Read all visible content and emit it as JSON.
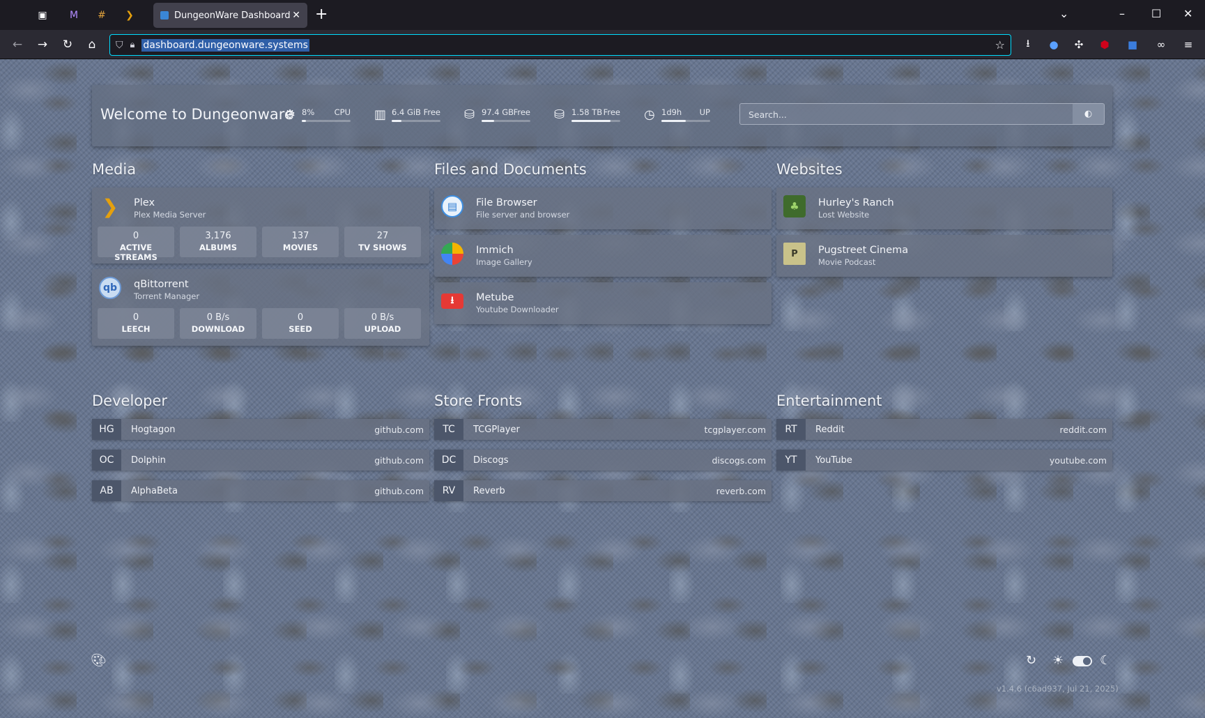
{
  "browser": {
    "tab_title": "DungeonWare Dashboard",
    "url": "dashboard.dungeonware.systems"
  },
  "header": {
    "title": "Welcome to Dungeonware",
    "search_placeholder": "Search...",
    "stats": [
      {
        "icon": "cpu-icon",
        "value": "8%",
        "label": "CPU",
        "fill": 0.08
      },
      {
        "icon": "memory-icon",
        "value": "6.4 GiB",
        "label": "Free",
        "fill": 0.2
      },
      {
        "icon": "disk-icon",
        "value": "97.4 GB",
        "label": "Free",
        "fill": 0.25
      },
      {
        "icon": "disk-icon",
        "value": "1.58 TB",
        "label": "Free",
        "fill": 0.8
      },
      {
        "icon": "clock-icon",
        "value": "1d9h",
        "label": "UP",
        "fill": 0.5
      }
    ]
  },
  "sections": {
    "media": "Media",
    "files": "Files and Documents",
    "websites": "Websites",
    "developer": "Developer",
    "store": "Store Fronts",
    "entertainment": "Entertainment"
  },
  "media": [
    {
      "name": "Plex",
      "desc": "Plex Media Server",
      "stats": [
        {
          "v": "0",
          "l": "ACTIVE STREAMS"
        },
        {
          "v": "3,176",
          "l": "ALBUMS"
        },
        {
          "v": "137",
          "l": "MOVIES"
        },
        {
          "v": "27",
          "l": "TV SHOWS"
        }
      ]
    },
    {
      "name": "qBittorrent",
      "desc": "Torrent Manager",
      "stats": [
        {
          "v": "0",
          "l": "LEECH"
        },
        {
          "v": "0 B/s",
          "l": "DOWNLOAD"
        },
        {
          "v": "0",
          "l": "SEED"
        },
        {
          "v": "0 B/s",
          "l": "UPLOAD"
        }
      ]
    }
  ],
  "files": [
    {
      "name": "File Browser",
      "desc": "File server and browser"
    },
    {
      "name": "Immich",
      "desc": "Image Gallery"
    },
    {
      "name": "Metube",
      "desc": "Youtube Downloader"
    }
  ],
  "websites": [
    {
      "name": "Hurley's Ranch",
      "desc": "Lost Website"
    },
    {
      "name": "Pugstreet Cinema",
      "desc": "Movie Podcast"
    }
  ],
  "developer": [
    {
      "abbr": "HG",
      "name": "Hogtagon",
      "domain": "github.com"
    },
    {
      "abbr": "OC",
      "name": "Dolphin",
      "domain": "github.com"
    },
    {
      "abbr": "AB",
      "name": "AlphaBeta",
      "domain": "github.com"
    }
  ],
  "store": [
    {
      "abbr": "TC",
      "name": "TCGPlayer",
      "domain": "tcgplayer.com"
    },
    {
      "abbr": "DC",
      "name": "Discogs",
      "domain": "discogs.com"
    },
    {
      "abbr": "RV",
      "name": "Reverb",
      "domain": "reverb.com"
    }
  ],
  "entertainment": [
    {
      "abbr": "RT",
      "name": "Reddit",
      "domain": "reddit.com"
    },
    {
      "abbr": "YT",
      "name": "YouTube",
      "domain": "youtube.com"
    }
  ],
  "footer": {
    "version": "v1.4.6 (c6ad937, Jul 21, 2025)"
  }
}
